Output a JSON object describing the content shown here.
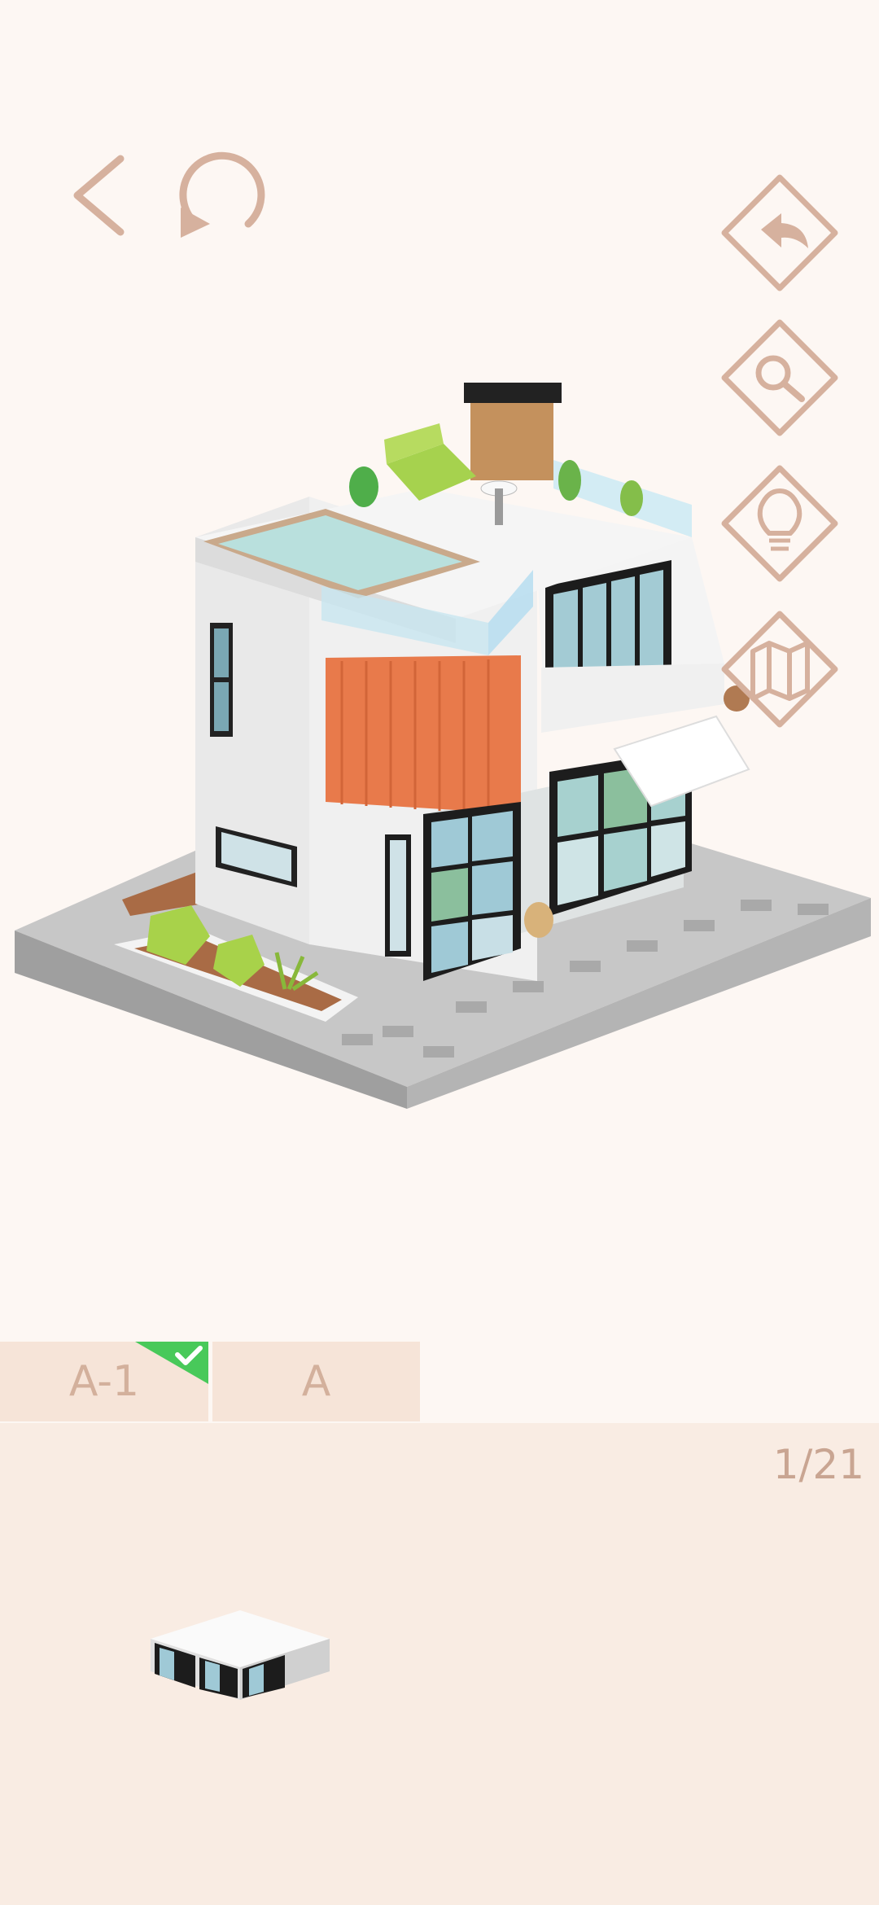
{
  "toolbar": {
    "back_icon": "chevron-left-icon",
    "reset_icon": "rotate-icon",
    "undo_icon": "undo-arrow-icon",
    "zoom_icon": "magnifier-icon",
    "hint_icon": "lightbulb-icon",
    "map_icon": "map-icon"
  },
  "tabs": [
    {
      "label": "A-1",
      "completed": true
    },
    {
      "label": "A",
      "completed": false
    }
  ],
  "tray": {
    "counter": "1/21",
    "piece_name": "glass-room-piece"
  },
  "colors": {
    "background": "#fdf7f3",
    "accent": "#d3b09c",
    "tab_bg": "#f6e4d8",
    "tray_bg": "#f9ece3",
    "check_green": "#48c95a"
  }
}
